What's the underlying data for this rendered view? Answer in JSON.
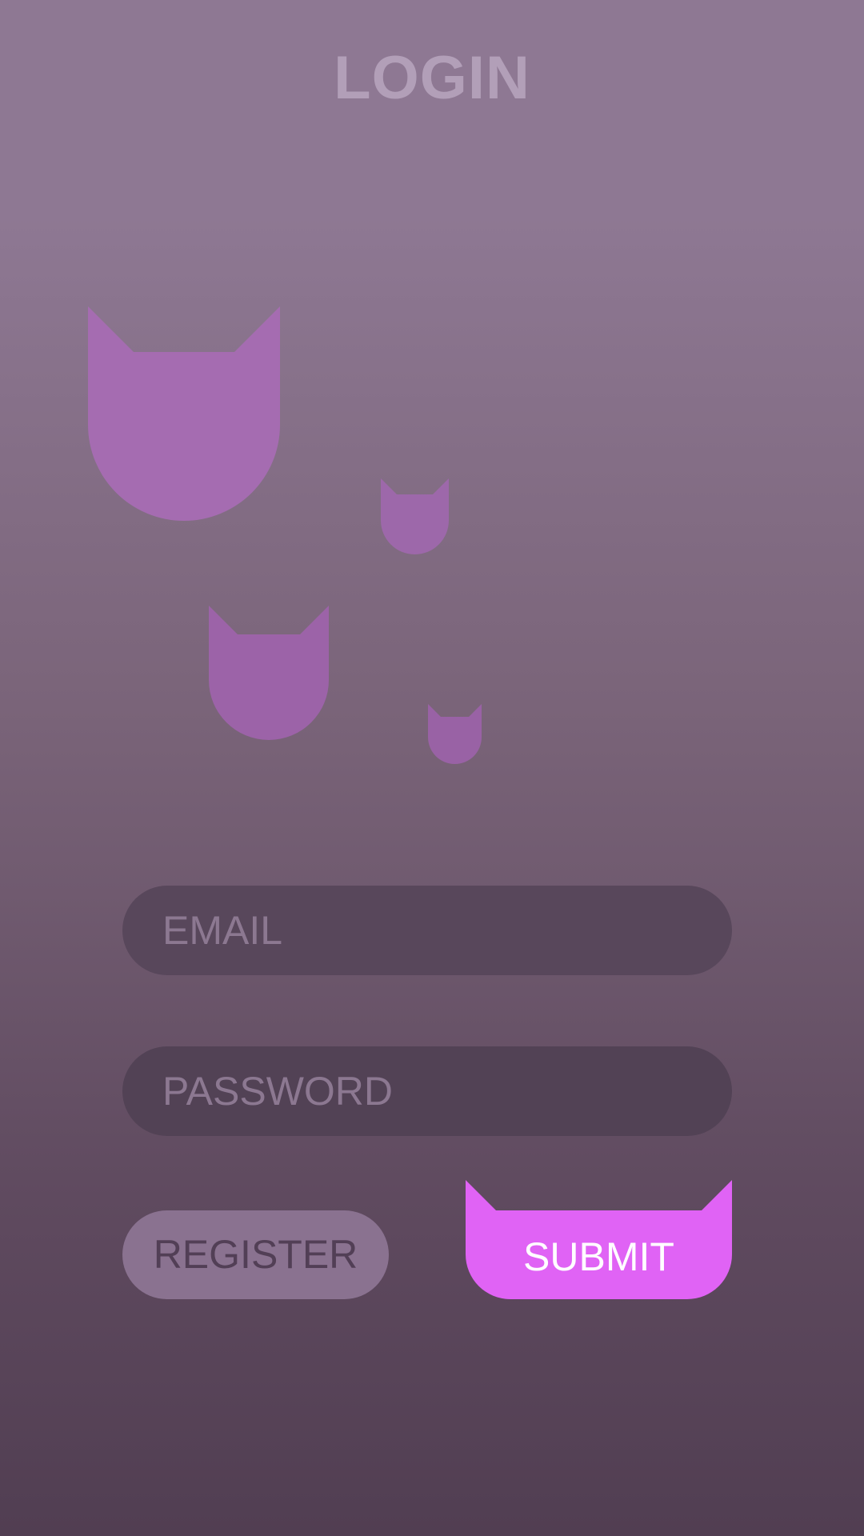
{
  "screen": {
    "title": "LOGIN"
  },
  "form": {
    "email_placeholder": "EMAIL",
    "email_value": "",
    "password_placeholder": "PASSWORD",
    "password_value": "",
    "register_label": "REGISTER",
    "submit_label": "SUBMIT"
  },
  "decorations": {
    "icons": [
      "cat-head-icon",
      "cat-head-icon",
      "cat-head-icon",
      "cat-head-icon"
    ]
  },
  "colors": {
    "accent": "#e063f5",
    "cat_decoration": "#a56cb1",
    "field_background": "#56465a",
    "register_background": "#8a7290",
    "title": "#b29fb8"
  }
}
